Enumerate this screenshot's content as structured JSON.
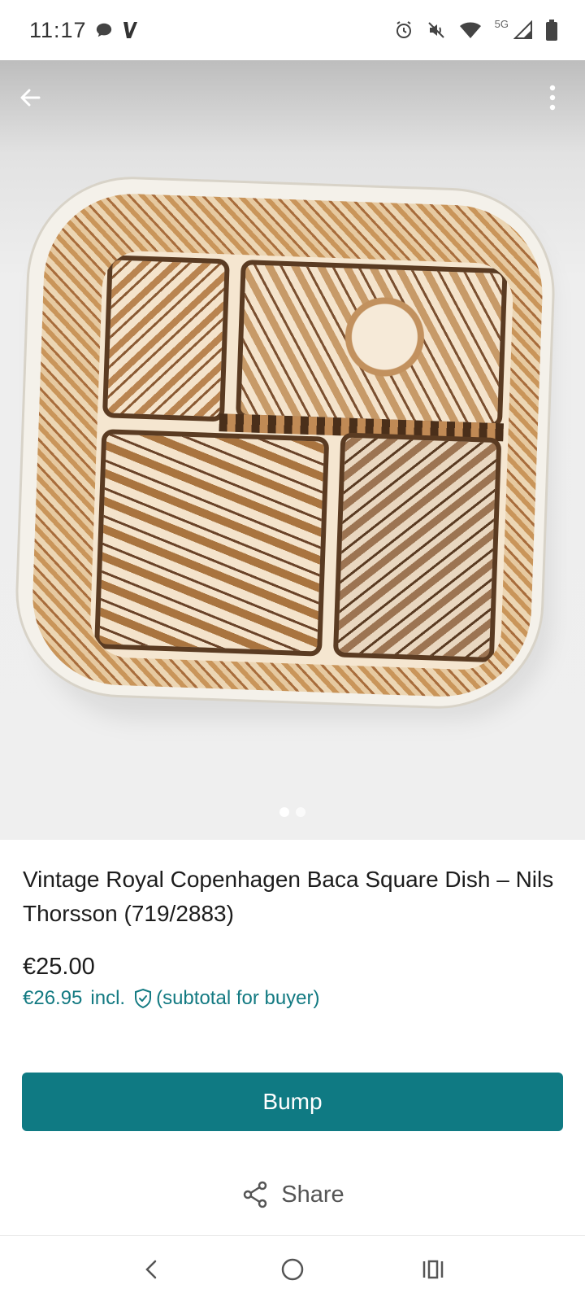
{
  "status_bar": {
    "time": "11:17",
    "network": "5G",
    "left_icons": [
      "chat-icon",
      "v-app-icon"
    ],
    "right_icons": [
      "alarm-icon",
      "mute-icon",
      "wifi-icon",
      "signal-icon",
      "battery-icon"
    ]
  },
  "toolbar": {
    "back_icon": "arrow-left-icon",
    "more_icon": "more-vertical-icon"
  },
  "gallery": {
    "image_count": 2,
    "active_index": 0
  },
  "listing": {
    "title": "Vintage Royal Copenhagen Baca Square Dish – Nils Thorsson (719/2883)",
    "price": "€25.00",
    "buyer_price": "€26.95",
    "buyer_price_incl": "incl.",
    "buyer_price_note": "(subtotal for buyer)"
  },
  "actions": {
    "bump_label": "Bump",
    "share_label": "Share"
  },
  "nav_bar": {
    "icons": [
      "nav-back-icon",
      "home-icon",
      "recents-icon"
    ]
  },
  "colors": {
    "accent": "#0f7a83",
    "buyer_price_text": "#137a82"
  }
}
